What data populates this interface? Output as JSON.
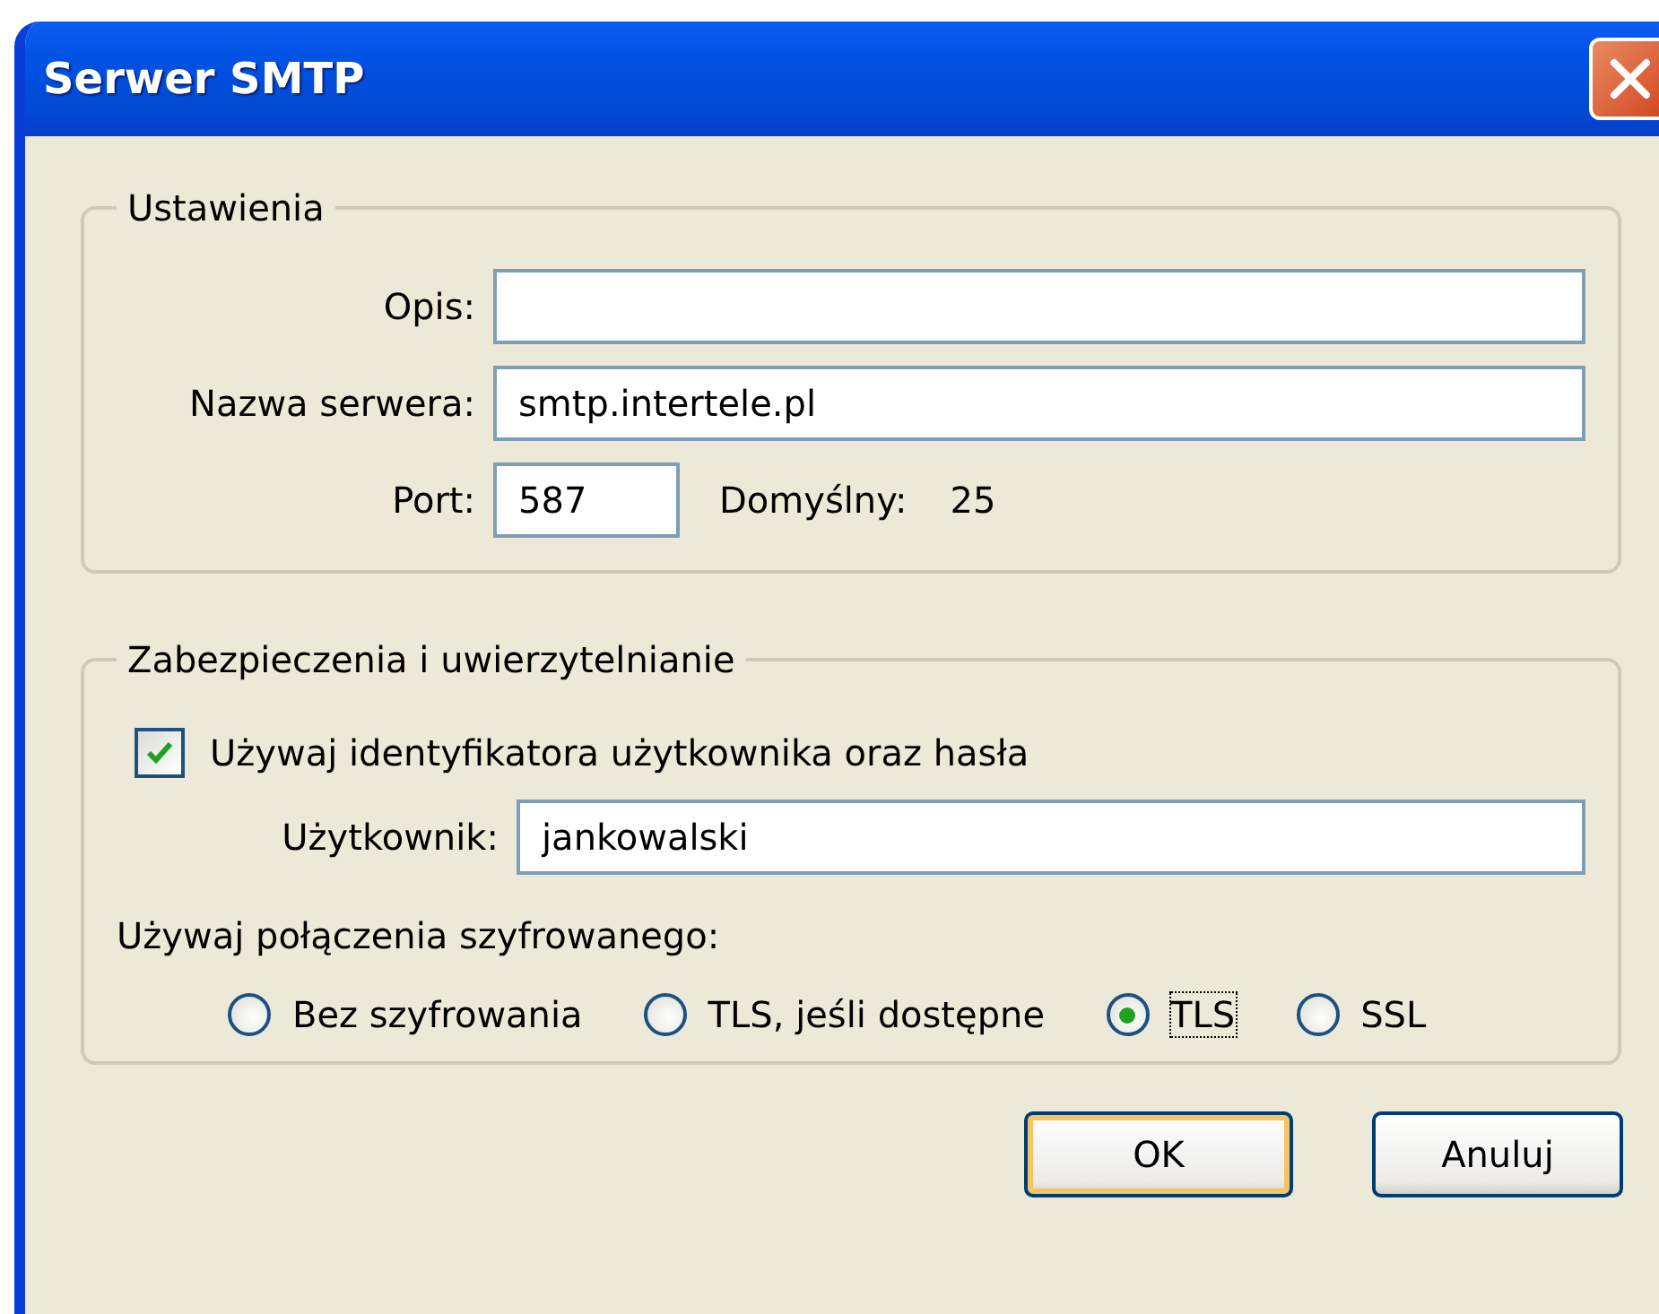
{
  "window": {
    "title": "Serwer SMTP"
  },
  "settings": {
    "legend": "Ustawienia",
    "description": {
      "label": "Opis:"
    },
    "server": {
      "label": "Nazwa serwera:",
      "value": "smtp.intertele.pl"
    },
    "port": {
      "label": "Port:",
      "value": "587",
      "default_label": "Domyślny:",
      "default_value": "25"
    }
  },
  "security": {
    "legend": "Zabezpieczenia i uwierzytelnianie",
    "use_auth": {
      "label": "Używaj identyfikatora użytkownika oraz hasła",
      "checked": true
    },
    "user": {
      "label": "Użytkownik:",
      "value": "jankowalski"
    },
    "encryption": {
      "label": "Używaj połączenia szyfrowanego:",
      "options": [
        {
          "label": "Bez szyfrowania",
          "selected": false
        },
        {
          "label": "TLS, jeśli dostępne",
          "selected": false
        },
        {
          "label": "TLS",
          "selected": true
        },
        {
          "label": "SSL",
          "selected": false
        }
      ]
    }
  },
  "buttons": [
    {
      "label": "OK",
      "default": true
    },
    {
      "label": "Anuluj",
      "default": false
    }
  ]
}
